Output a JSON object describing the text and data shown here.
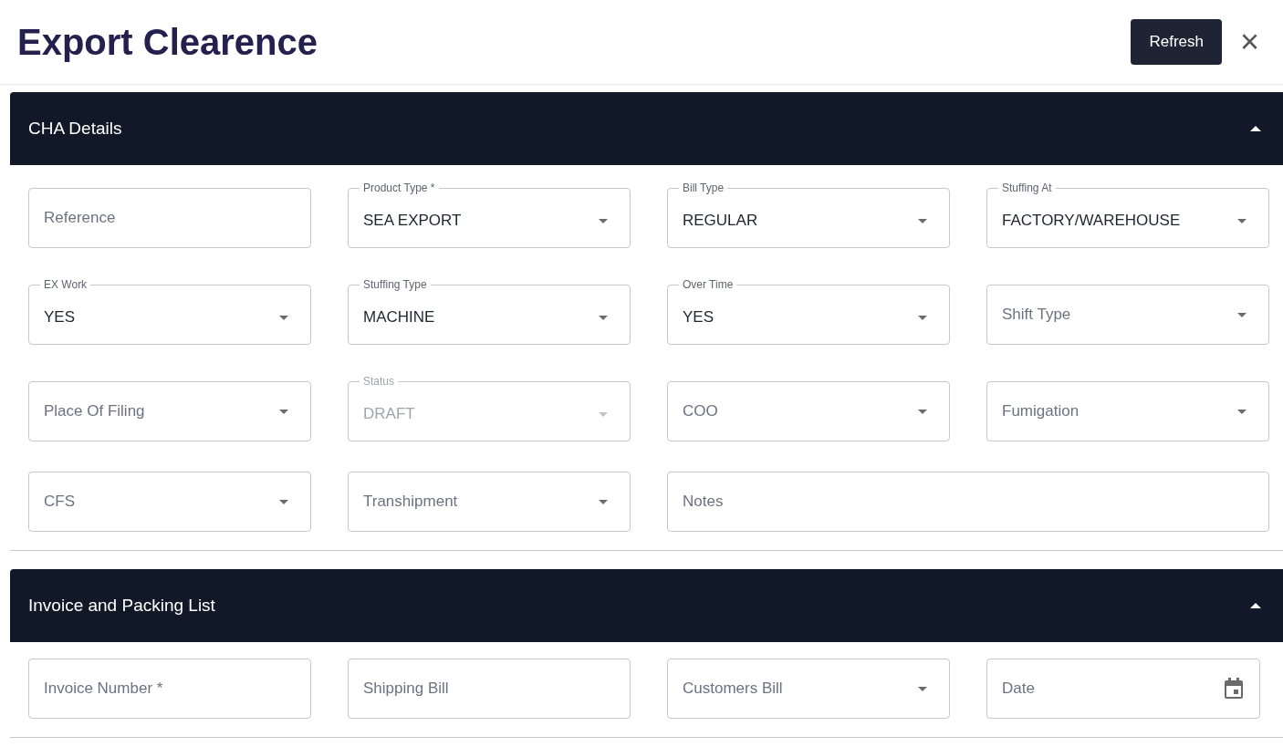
{
  "header": {
    "title": "Export Clearence",
    "refresh_button": "Refresh",
    "close_button": "×"
  },
  "sections": [
    {
      "title": "CHA Details",
      "expanded": true,
      "fields": [
        {
          "kind": "text",
          "placeholder": "Reference",
          "disabled": false
        },
        {
          "kind": "select",
          "label": "Product Type *",
          "value": "SEA EXPORT",
          "disabled": false
        },
        {
          "kind": "select",
          "label": "Bill Type",
          "value": "REGULAR",
          "disabled": false
        },
        {
          "kind": "select",
          "label": "Stuffing At",
          "value": "FACTORY/WAREHOUSE",
          "disabled": false
        },
        {
          "kind": "select",
          "label": "EX Work",
          "value": "YES",
          "disabled": false
        },
        {
          "kind": "select",
          "label": "Stuffing Type",
          "value": "MACHINE",
          "disabled": false
        },
        {
          "kind": "select",
          "label": "Over Time",
          "value": "YES",
          "disabled": false
        },
        {
          "kind": "select",
          "placeholder": "Shift Type",
          "disabled": false
        },
        {
          "kind": "select",
          "placeholder": "Place Of Filing",
          "disabled": false
        },
        {
          "kind": "select",
          "label": "Status",
          "value": "DRAFT",
          "disabled": true
        },
        {
          "kind": "select",
          "placeholder": "COO",
          "disabled": false
        },
        {
          "kind": "select",
          "placeholder": "Fumigation",
          "disabled": false
        },
        {
          "kind": "select",
          "placeholder": "CFS",
          "disabled": false
        },
        {
          "kind": "select",
          "placeholder": "Transhipment",
          "disabled": false
        },
        {
          "kind": "notes",
          "placeholder": "Notes",
          "disabled": false
        }
      ]
    },
    {
      "title": "Invoice and Packing List",
      "expanded": true,
      "fields": [
        {
          "kind": "text",
          "placeholder": "Invoice Number *",
          "disabled": false
        },
        {
          "kind": "text",
          "placeholder": "Shipping Bill",
          "disabled": false
        },
        {
          "kind": "select",
          "placeholder": "Customers Bill",
          "disabled": false
        },
        {
          "kind": "date",
          "placeholder": "Date",
          "disabled": false
        }
      ]
    }
  ]
}
